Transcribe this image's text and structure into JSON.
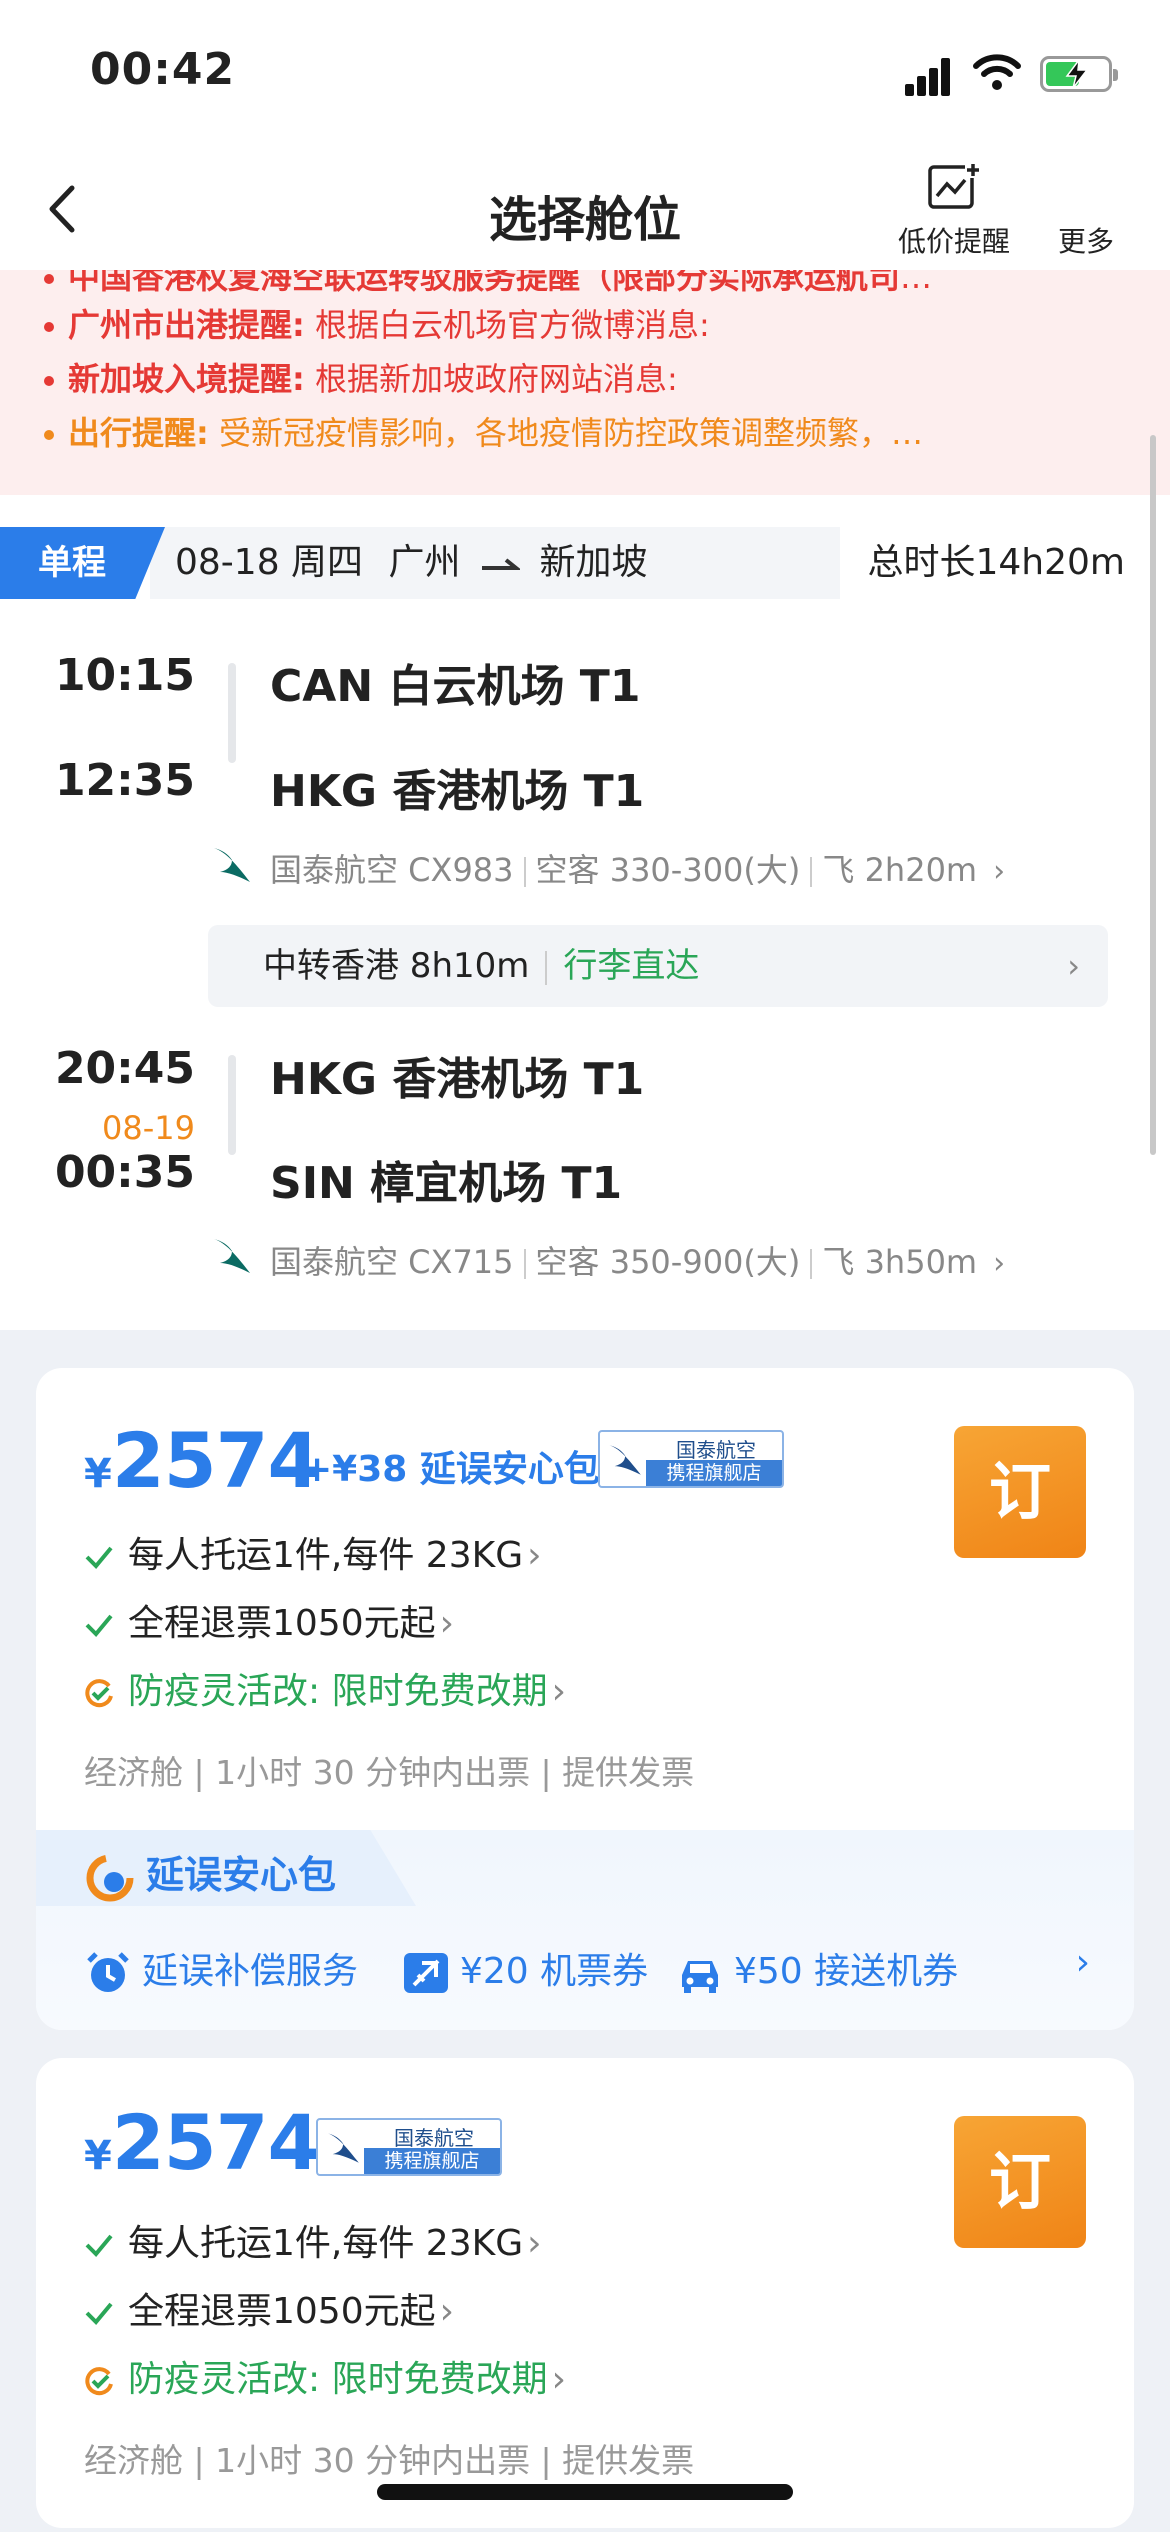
{
  "status_bar": {
    "time": "00:42"
  },
  "nav": {
    "title": "选择舱位",
    "low_price_alert": "低价提醒",
    "more": "更多"
  },
  "notices": [
    {
      "label": "中国香港权复海空联运转驳服务提醒（限部分实际承运航司",
      "text": "…"
    },
    {
      "label": "广州市出港提醒:",
      "text": "根据白云机场官方微博消息:"
    },
    {
      "label": "新加坡入境提醒:",
      "text": "根据新加坡政府网站消息:"
    },
    {
      "label": "出行提醒:",
      "text": "受新冠疫情影响，各地疫情防控政策调整频繁，…"
    }
  ],
  "trip": {
    "tag": "单程",
    "date": "08-18 周四",
    "from_city": "广州",
    "to_city": "新加坡",
    "duration": "总时长14h20m"
  },
  "segments": [
    {
      "dep_time": "10:15",
      "dep_airport": "CAN 白云机场 T1",
      "arr_time": "12:35",
      "arr_airport": "HKG 香港机场 T1",
      "airline": "国泰航空 CX983",
      "aircraft": "空客 330-300(大)",
      "flight_time": "飞 2h20m"
    },
    {
      "dep_time": "20:45",
      "dep_airport": "HKG 香港机场 T1",
      "arr_date": "08-19",
      "arr_time": "00:35",
      "arr_airport": "SIN 樟宜机场 T1",
      "airline": "国泰航空 CX715",
      "aircraft": "空客 350-900(大)",
      "flight_time": "飞 3h50m"
    }
  ],
  "transfer": {
    "text": "中转香港 8h10m",
    "baggage": "行李直达"
  },
  "offers": [
    {
      "currency": "¥",
      "price": "2574",
      "addon": "+¥38 延误安心包",
      "shop_line1": "国泰航空",
      "shop_line2": "携程旗舰店",
      "book": "订",
      "baggage": "每人托运1件,每件 23KG",
      "refund": "全程退票1050元起",
      "change_label": "防疫灵活改:",
      "change_text": "限时免费改期",
      "meta": "经济舱 | 1小时 30 分钟内出票 | 提供发票",
      "insurance": {
        "title": "延误安心包",
        "services": [
          "延误补偿服务",
          "¥20 机票券",
          "¥50 接送机券"
        ]
      }
    },
    {
      "currency": "¥",
      "price": "2574",
      "shop_line1": "国泰航空",
      "shop_line2": "携程旗舰店",
      "book": "订",
      "baggage": "每人托运1件,每件 23KG",
      "refund": "全程退票1050元起",
      "change_label": "防疫灵活改:",
      "change_text": "限时免费改期",
      "meta": "经济舱 | 1小时 30 分钟内出票 | 提供发票"
    }
  ],
  "colors": {
    "brand_blue": "#2b7de9",
    "orange": "#f08a1c",
    "alert_red": "#e53935",
    "green": "#2aa657"
  },
  "battery_level": 0.55
}
